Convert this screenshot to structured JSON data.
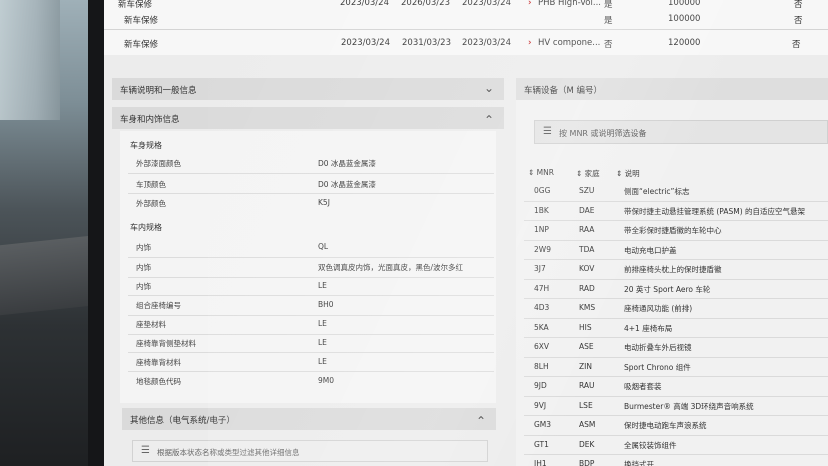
{
  "top_table": {
    "rows": [
      {
        "type": "新车保修",
        "start": "2023/03/24",
        "end": "2026/03/23",
        "date3": "2023/03/24",
        "desc": "PHB High-Vol...",
        "flag": "是",
        "mileage": "100000",
        "last": "否"
      },
      {
        "type": "新车保修",
        "start": "2023/03/24",
        "end": "2031/03/23",
        "date3": "2023/03/24",
        "desc": "HV compone...",
        "flag": "否",
        "mileage": "120000",
        "last": "否"
      }
    ]
  },
  "left": {
    "section_general": "车辆说明和一般信息",
    "section_body": "车身和内饰信息",
    "group_body_spec": "车身规格",
    "body_rows": [
      {
        "k": "外部漆面颜色",
        "v": "D0 冰晶蓝金属漆"
      },
      {
        "k": "车顶颜色",
        "v": "D0 冰晶蓝金属漆"
      },
      {
        "k": "外部颜色",
        "v": "K5J"
      }
    ],
    "group_interior_spec": "车内规格",
    "interior_rows": [
      {
        "k": "内饰",
        "v": "QL"
      },
      {
        "k": "内饰",
        "v": "双色调真皮内饰，光面真皮，黑色/波尔多红"
      },
      {
        "k": "内饰",
        "v": "LE"
      },
      {
        "k": "组合座椅编号",
        "v": "BH0"
      },
      {
        "k": "座垫材料",
        "v": "LE"
      },
      {
        "k": "座椅靠背侧垫材料",
        "v": "LE"
      },
      {
        "k": "座椅靠背材料",
        "v": "LE"
      },
      {
        "k": "地毯颜色代码",
        "v": "9M0"
      }
    ],
    "section_other": "其他信息（电气系统/电子）",
    "filter_placeholder": "根据版本状态名称或类型过滤其他详细信息"
  },
  "right": {
    "header": "车辆设备（M 编号）",
    "filter_placeholder": "按 MNR 或说明筛选设备",
    "columns": [
      "MNR",
      "家庭",
      "说明"
    ],
    "rows": [
      {
        "mnr": "0GG",
        "family": "SZU",
        "desc": "侧面“electric”标志"
      },
      {
        "mnr": "1BK",
        "family": "DAE",
        "desc": "带保时捷主动悬挂管理系统 (PASM) 的自适应空气悬架"
      },
      {
        "mnr": "1NP",
        "family": "RAA",
        "desc": "带全彩保时捷盾徽的车轮中心"
      },
      {
        "mnr": "2W9",
        "family": "TDA",
        "desc": "电动充电口护盖"
      },
      {
        "mnr": "3J7",
        "family": "KOV",
        "desc": "前排座椅头枕上的保时捷盾徽"
      },
      {
        "mnr": "47H",
        "family": "RAD",
        "desc": "20 英寸 Sport Aero 车轮"
      },
      {
        "mnr": "4D3",
        "family": "KMS",
        "desc": "座椅通风功能 (前排)"
      },
      {
        "mnr": "5KA",
        "family": "HIS",
        "desc": "4+1 座椅布局"
      },
      {
        "mnr": "6XV",
        "family": "ASE",
        "desc": "电动折叠车外后视镜"
      },
      {
        "mnr": "8LH",
        "family": "ZIN",
        "desc": "Sport Chrono 组件"
      },
      {
        "mnr": "9JD",
        "family": "RAU",
        "desc": "吸烟者套装"
      },
      {
        "mnr": "9VJ",
        "family": "LSE",
        "desc": "Burmester® 高端 3D环绕声音响系统"
      },
      {
        "mnr": "GM3",
        "family": "ASM",
        "desc": "保时捷电动跑车声浪系统"
      },
      {
        "mnr": "GT1",
        "family": "DEK",
        "desc": "全属铰装饰组件"
      },
      {
        "mnr": "JH1",
        "family": "BDP",
        "desc": "换挡式开..."
      }
    ]
  }
}
